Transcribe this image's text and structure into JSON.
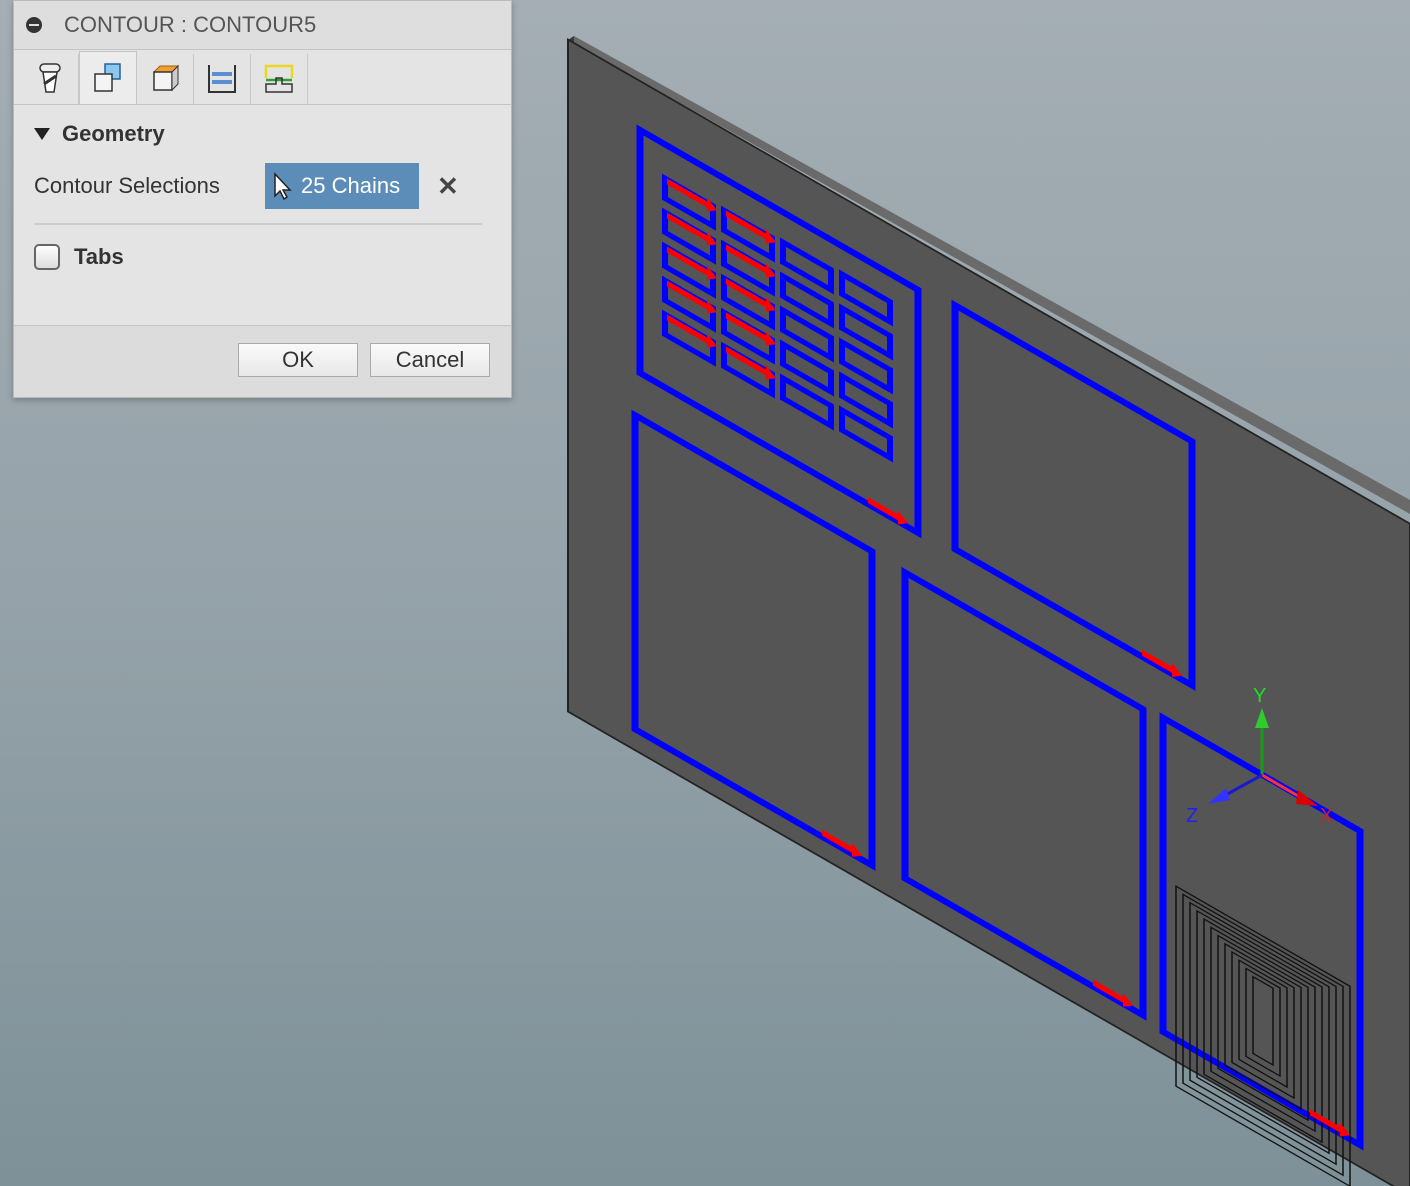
{
  "dialog": {
    "title": "CONTOUR : CONTOUR5",
    "tabs": [
      {
        "icon": "tool-icon"
      },
      {
        "icon": "geometry-icon",
        "active": true
      },
      {
        "icon": "heights-icon"
      },
      {
        "icon": "passes-icon"
      },
      {
        "icon": "linking-icon"
      }
    ],
    "geometry_section": "Geometry",
    "contour_selections_label": "Contour Selections",
    "contour_selections_value": "25 Chains",
    "clear_symbol": "✕",
    "tabs_label": "Tabs",
    "tabs_checked": false,
    "ok_label": "OK",
    "cancel_label": "Cancel"
  },
  "viewport": {
    "axis_labels": {
      "x": "X",
      "y": "Y",
      "z": "Z"
    },
    "colors": {
      "selected_contour": "#0000ff",
      "direction_arrow": "#ff0000",
      "plate": "#555555",
      "selection_button": "#5b8db8"
    }
  }
}
